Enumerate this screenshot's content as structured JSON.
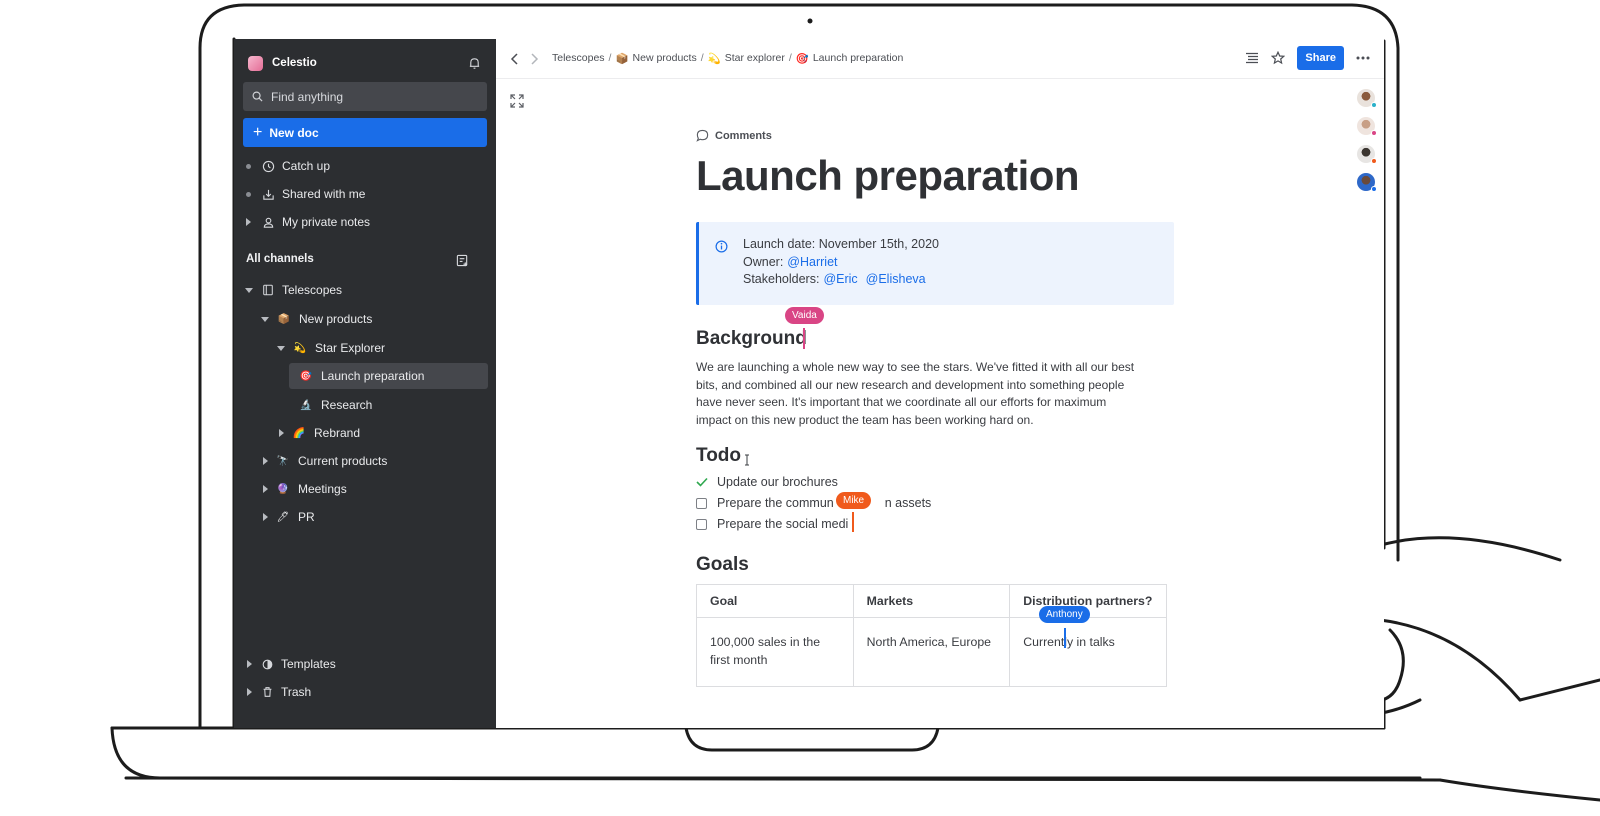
{
  "app": {
    "name": "Celestio"
  },
  "sidebar": {
    "search_placeholder": "Find anything",
    "new_doc": "New doc",
    "top_items": [
      {
        "label": "Catch up",
        "icon": "clock-icon"
      },
      {
        "label": "Shared with me",
        "icon": "inbox-download-icon"
      },
      {
        "label": "My private notes",
        "icon": "person-icon"
      }
    ],
    "channels_title": "All channels",
    "tree": {
      "telescopes": "Telescopes",
      "new_products": "New products",
      "star_explorer": "Star Explorer",
      "launch_preparation": "Launch preparation",
      "research": "Research",
      "rebrand": "Rebrand",
      "current_products": "Current products",
      "meetings": "Meetings",
      "pr": "PR"
    },
    "bottom_items": {
      "templates": "Templates",
      "trash": "Trash"
    }
  },
  "topbar": {
    "breadcrumbs": [
      {
        "label": "Telescopes",
        "emoji": ""
      },
      {
        "label": "New products",
        "emoji": "📦"
      },
      {
        "label": "Star explorer",
        "emoji": "💫"
      },
      {
        "label": "Launch preparation",
        "emoji": "🎯"
      }
    ],
    "separator": "/",
    "share_label": "Share"
  },
  "doc": {
    "comments_label": "Comments",
    "title": "Launch preparation",
    "callout": {
      "launch_date": "Launch date: November 15th, 2020",
      "owner_label": "Owner:",
      "owner": "@Harriet",
      "stakeholders_label": "Stakeholders:",
      "stakeholder_1": "@Eric",
      "stakeholder_2": "@Elisheva"
    },
    "background_heading": "Background",
    "background_text_1": "We are launching a whole new way to see the stars. We've fitted it with all our best",
    "background_text_2": "bits, and combined all our new research and development into something people",
    "background_text_3": "have never seen. It's important that we coordinate all our efforts for maximum",
    "background_text_4": "impact on this new product the team has been working hard on.",
    "todo_heading": "Todo",
    "todos": [
      {
        "label": "Update our brochures",
        "done": true
      },
      {
        "label_before": "Prepare the commun",
        "label_after": "n assets",
        "done": false
      },
      {
        "label": "Prepare the social medi",
        "done": false
      }
    ],
    "goals_heading": "Goals",
    "goals_table": {
      "headers": [
        "Goal",
        "Markets",
        "Distribution partners?"
      ],
      "row_1": {
        "goal_line_1": "100,000 sales in the",
        "goal_line_2": "first month",
        "markets": "North America, Europe",
        "partners": "Currently in talks"
      }
    }
  },
  "collaborators": {
    "vaida": {
      "name": "Vaida",
      "color": "#d94585"
    },
    "mike": {
      "name": "Mike",
      "color": "#f05a1c"
    },
    "anthony": {
      "name": "Anthony",
      "color": "#1a6de8"
    }
  }
}
